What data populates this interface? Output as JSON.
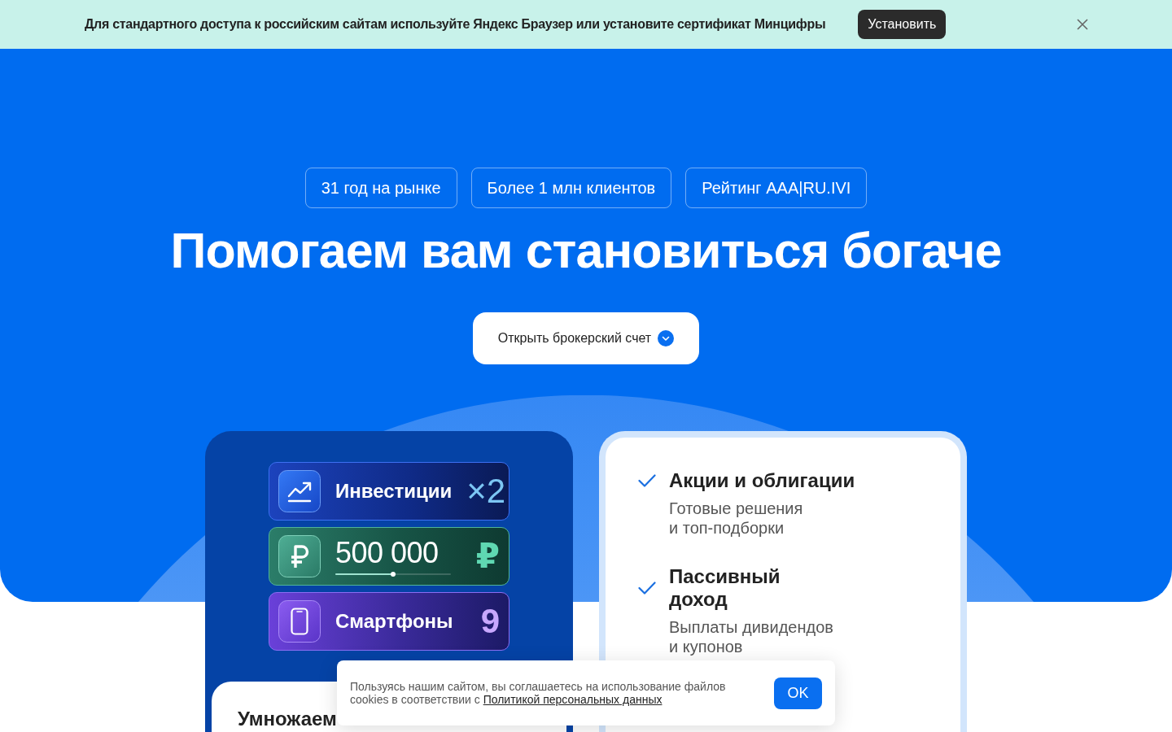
{
  "notice_bar": {
    "text": "Для стандартного доступа к российским сайтам используйте Яндекс Браузер или установите сертификат Минцифры",
    "button": "Установить"
  },
  "hero": {
    "badges": [
      "31 год на рынке",
      "Более 1 млн клиентов",
      "Рейтинг AAA|RU.IVI"
    ],
    "title": "Помогаем вам становиться богаче",
    "cta_button": "Открыть брокерский счет"
  },
  "promo_card": {
    "tiles": [
      {
        "kind": "investments",
        "label": "Инвестиции",
        "value": "×2"
      },
      {
        "kind": "amount",
        "label": "500 000",
        "level": 0.5,
        "value": "₽"
      },
      {
        "kind": "phones",
        "label": "Смартфоны",
        "value": "9"
      }
    ],
    "subcard_title": "Умножаем"
  },
  "features_card": {
    "items": [
      {
        "title": "Акции и облигации",
        "description": "Готовые решения\nи топ-подборки"
      },
      {
        "title": "Пассивный\nдоход",
        "description": "Выплаты дивидендов\nи купонов"
      }
    ]
  },
  "cookie_banner": {
    "text": "Пользуясь нашим сайтом, вы соглашаетесь на использование файлов cookies в соответствии с ",
    "link": "Политикой персональных данных",
    "button": "OK"
  }
}
